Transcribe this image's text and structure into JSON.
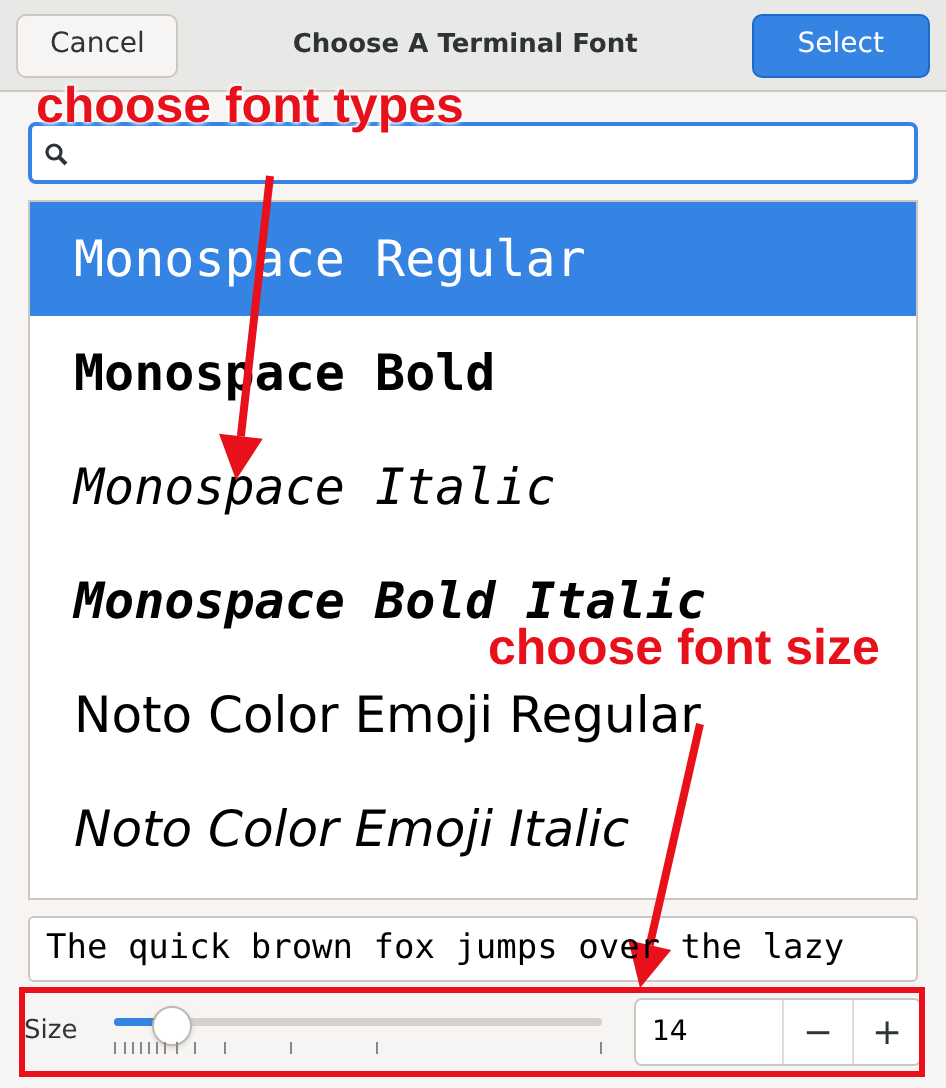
{
  "header": {
    "cancel": "Cancel",
    "title": "Choose A Terminal Font",
    "select": "Select"
  },
  "fonts": [
    {
      "label": "Monospace Regular",
      "kind": "mono",
      "selected": true
    },
    {
      "label": "Monospace Bold",
      "kind": "monobold",
      "selected": false
    },
    {
      "label": "Monospace Italic",
      "kind": "monoitalic",
      "selected": false
    },
    {
      "label": "Monospace Bold Italic",
      "kind": "monobolditalic",
      "selected": false
    },
    {
      "label": "Noto Color Emoji Regular",
      "kind": "sans",
      "selected": false
    },
    {
      "label": "Noto Color Emoji Italic",
      "kind": "sansitalic",
      "selected": false
    }
  ],
  "preview": "The quick brown fox jumps over the lazy",
  "size": {
    "label": "Size",
    "level": 0.12,
    "value": "14",
    "minus": "−",
    "plus": "+"
  },
  "annotations": [
    {
      "kind": "label",
      "text": "choose font types"
    },
    {
      "kind": "arrow"
    },
    {
      "kind": "label",
      "text": "choose font size"
    },
    {
      "kind": "arrow"
    },
    {
      "kind": "frame"
    }
  ]
}
